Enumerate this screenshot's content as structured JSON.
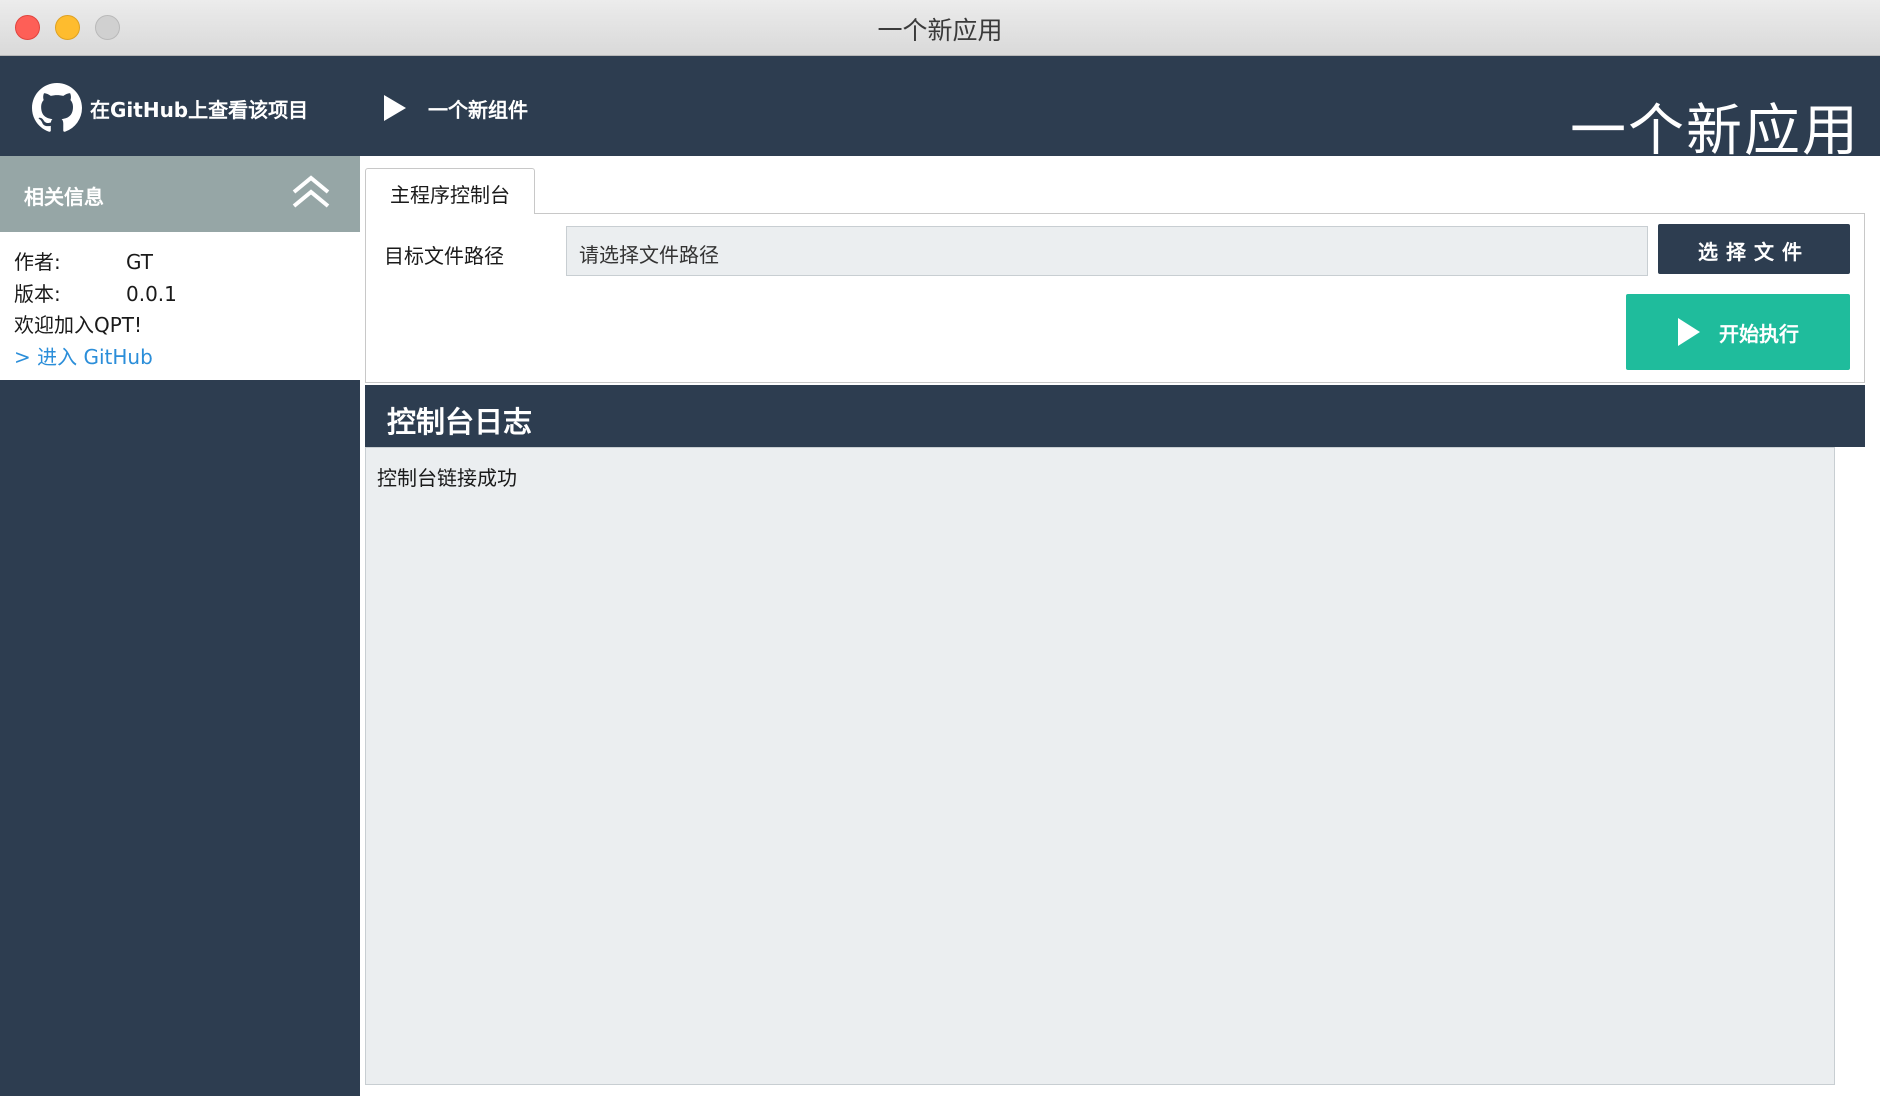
{
  "window": {
    "title": "一个新应用"
  },
  "header": {
    "github_link": "在GitHub上查看该项目",
    "widget_link": "一个新组件",
    "app_title": "一个新应用"
  },
  "sidebar": {
    "info_title": "相关信息",
    "author_key": "作者:",
    "author_value": "GT",
    "version_key": "版本:",
    "version_value": "0.0.1",
    "welcome": "欢迎加入QPT!",
    "github_enter": "> 进入 GitHub"
  },
  "main": {
    "tab_label": "主程序控制台",
    "path_label": "目标文件路径",
    "path_placeholder": "请选择文件路径",
    "choose_button": "选择文件",
    "run_button": "开始执行",
    "log_title": "控制台日志",
    "log_lines": [
      "控制台链接成功"
    ]
  },
  "colors": {
    "header_bg": "#2d3d50",
    "info_header_bg": "#96a6a6",
    "run_button": "#1fbc9c",
    "link": "#2b8ed9"
  },
  "icons": {
    "github": "github-icon",
    "play": "play-icon",
    "collapse": "chevron-double-up-icon"
  }
}
